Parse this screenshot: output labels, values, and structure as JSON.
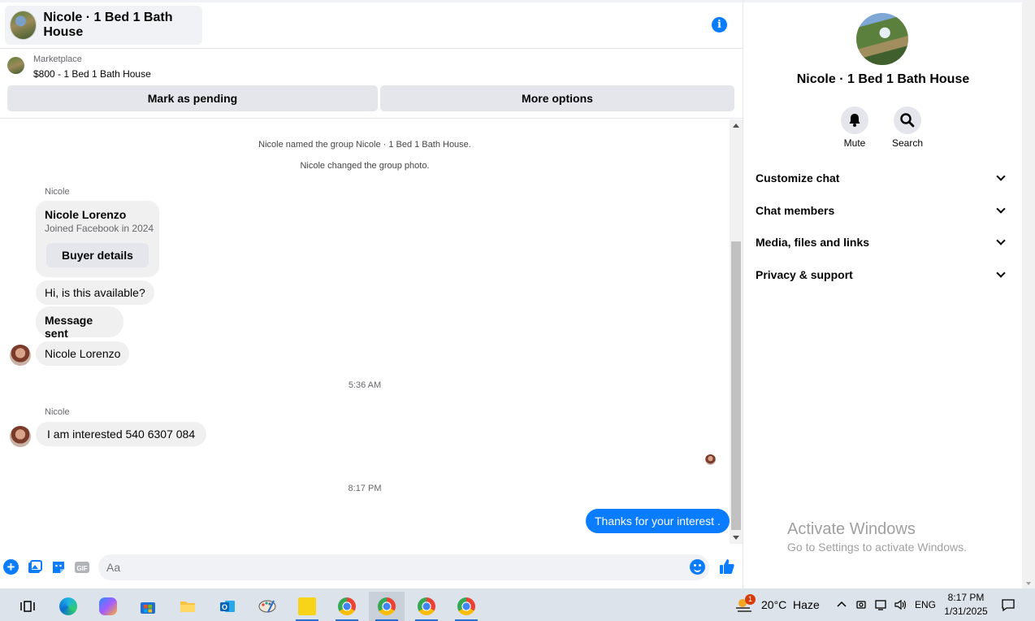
{
  "chat": {
    "title": "Nicole · 1 Bed 1 Bath House",
    "listing": {
      "source": "Marketplace",
      "title": "$800 - 1 Bed 1 Bath House",
      "mark_pending": "Mark as pending",
      "more_options": "More options"
    },
    "system_messages": [
      "Nicole named the group Nicole · 1 Bed 1 Bath House.",
      "Nicole changed the group photo."
    ],
    "sender_name": "Nicole",
    "profile_card": {
      "name": "Nicole Lorenzo",
      "subtitle": "Joined Facebook in 2024",
      "button": "Buyer details"
    },
    "messages": [
      "Hi, is this available?",
      "Message sent",
      "Nicole Lorenzo"
    ],
    "timestamp_1": "5:36 AM",
    "sender_name_2": "Nicole",
    "message_4": "I am interested 540 6307 084",
    "timestamp_2": "8:17 PM",
    "outgoing_message": "Thanks for your interest .",
    "composer_placeholder": "Aa"
  },
  "sidebar": {
    "title": "Nicole · 1 Bed 1 Bath House",
    "actions": {
      "mute": "Mute",
      "search": "Search"
    },
    "menu": [
      "Customize chat",
      "Chat members",
      "Media, files and links",
      "Privacy & support"
    ],
    "watermark_title": "Activate Windows",
    "watermark_sub": "Go to Settings to activate Windows."
  },
  "taskbar": {
    "weather": "20°C  Haze",
    "weather_badge": "1",
    "language": "ENG",
    "time": "8:17 PM",
    "date": "1/31/2025"
  },
  "colors": {
    "accent": "#0a7cff",
    "bubble": "#f0f0f0",
    "button": "#e4e6eb"
  }
}
